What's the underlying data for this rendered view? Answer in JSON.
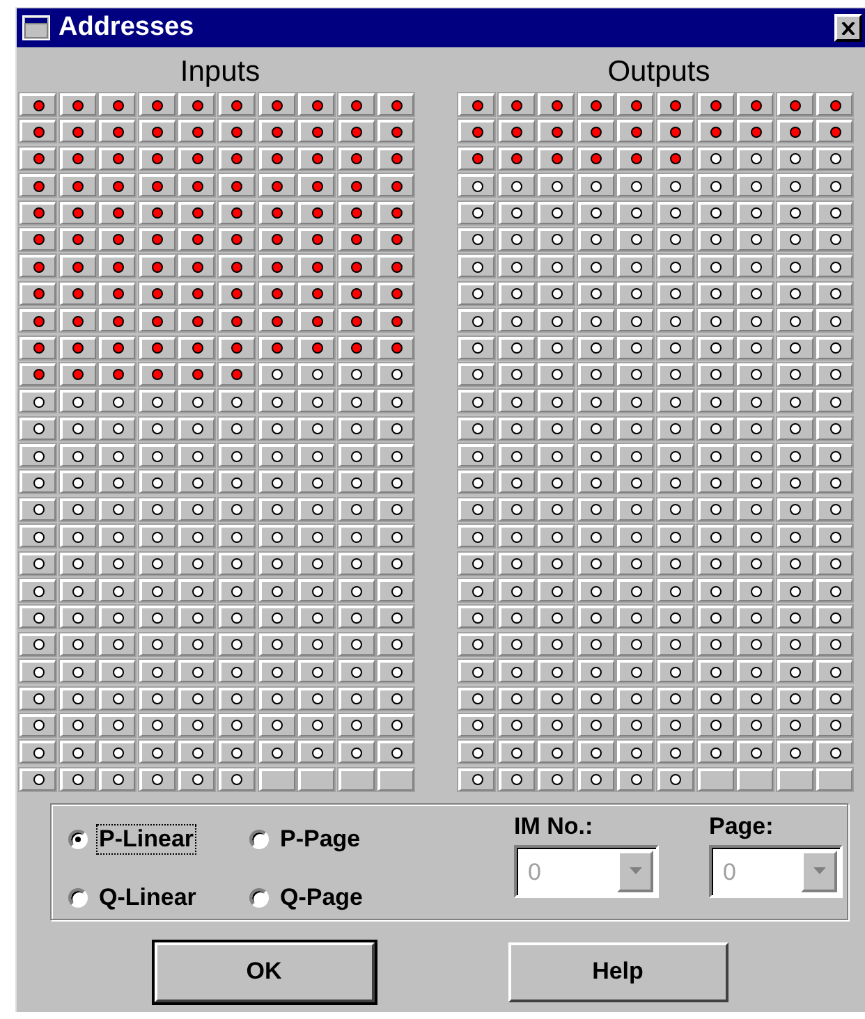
{
  "window": {
    "title": "Addresses"
  },
  "panels": [
    {
      "label": "Inputs",
      "rows": [
        [
          {
            "on": true
          },
          {
            "on": true
          },
          {
            "on": true
          },
          {
            "on": true
          },
          {
            "on": true
          },
          {
            "on": true
          },
          {
            "on": true
          },
          {
            "on": true
          },
          {
            "on": true
          },
          {
            "on": true
          }
        ],
        [
          {
            "on": true
          },
          {
            "on": true
          },
          {
            "on": true
          },
          {
            "on": true
          },
          {
            "on": true
          },
          {
            "on": true
          },
          {
            "on": true
          },
          {
            "on": true
          },
          {
            "on": true
          },
          {
            "on": true
          }
        ],
        [
          {
            "on": true
          },
          {
            "on": true
          },
          {
            "on": true
          },
          {
            "on": true
          },
          {
            "on": true
          },
          {
            "on": true
          },
          {
            "on": true
          },
          {
            "on": true
          },
          {
            "on": true
          },
          {
            "on": true
          }
        ],
        [
          {
            "on": true
          },
          {
            "on": true
          },
          {
            "on": true
          },
          {
            "on": true
          },
          {
            "on": true
          },
          {
            "on": true
          },
          {
            "on": true
          },
          {
            "on": true
          },
          {
            "on": true
          },
          {
            "on": true
          }
        ],
        [
          {
            "on": true
          },
          {
            "on": true
          },
          {
            "on": true
          },
          {
            "on": true
          },
          {
            "on": true
          },
          {
            "on": true
          },
          {
            "on": true
          },
          {
            "on": true
          },
          {
            "on": true
          },
          {
            "on": true
          }
        ],
        [
          {
            "on": true
          },
          {
            "on": true
          },
          {
            "on": true
          },
          {
            "on": true
          },
          {
            "on": true
          },
          {
            "on": true
          },
          {
            "on": true
          },
          {
            "on": true
          },
          {
            "on": true
          },
          {
            "on": true
          }
        ],
        [
          {
            "on": true
          },
          {
            "on": true
          },
          {
            "on": true
          },
          {
            "on": true
          },
          {
            "on": true
          },
          {
            "on": true
          },
          {
            "on": true
          },
          {
            "on": true
          },
          {
            "on": true
          },
          {
            "on": true
          }
        ],
        [
          {
            "on": true
          },
          {
            "on": true
          },
          {
            "on": true
          },
          {
            "on": true
          },
          {
            "on": true
          },
          {
            "on": true
          },
          {
            "on": true
          },
          {
            "on": true
          },
          {
            "on": true
          },
          {
            "on": true
          }
        ],
        [
          {
            "on": true
          },
          {
            "on": true
          },
          {
            "on": true
          },
          {
            "on": true
          },
          {
            "on": true
          },
          {
            "on": true
          },
          {
            "on": true
          },
          {
            "on": true
          },
          {
            "on": true
          },
          {
            "on": true
          }
        ],
        [
          {
            "on": true
          },
          {
            "on": true
          },
          {
            "on": true
          },
          {
            "on": true
          },
          {
            "on": true
          },
          {
            "on": true
          },
          {
            "on": true
          },
          {
            "on": true
          },
          {
            "on": true
          },
          {
            "on": true
          }
        ],
        [
          {
            "on": true
          },
          {
            "on": true
          },
          {
            "on": true
          },
          {
            "on": true
          },
          {
            "on": true
          },
          {
            "on": true
          },
          {
            "on": false
          },
          {
            "on": false
          },
          {
            "on": false
          },
          {
            "on": false
          }
        ],
        [
          {
            "on": false
          },
          {
            "on": false
          },
          {
            "on": false
          },
          {
            "on": false
          },
          {
            "on": false
          },
          {
            "on": false
          },
          {
            "on": false
          },
          {
            "on": false
          },
          {
            "on": false
          },
          {
            "on": false
          }
        ],
        [
          {
            "on": false
          },
          {
            "on": false
          },
          {
            "on": false
          },
          {
            "on": false
          },
          {
            "on": false
          },
          {
            "on": false
          },
          {
            "on": false
          },
          {
            "on": false
          },
          {
            "on": false
          },
          {
            "on": false
          }
        ],
        [
          {
            "on": false
          },
          {
            "on": false
          },
          {
            "on": false
          },
          {
            "on": false
          },
          {
            "on": false
          },
          {
            "on": false
          },
          {
            "on": false
          },
          {
            "on": false
          },
          {
            "on": false
          },
          {
            "on": false
          }
        ],
        [
          {
            "on": false
          },
          {
            "on": false
          },
          {
            "on": false
          },
          {
            "on": false
          },
          {
            "on": false
          },
          {
            "on": false
          },
          {
            "on": false
          },
          {
            "on": false
          },
          {
            "on": false
          },
          {
            "on": false
          }
        ],
        [
          {
            "on": false
          },
          {
            "on": false
          },
          {
            "on": false
          },
          {
            "on": false
          },
          {
            "on": false
          },
          {
            "on": false
          },
          {
            "on": false
          },
          {
            "on": false
          },
          {
            "on": false
          },
          {
            "on": false
          }
        ],
        [
          {
            "on": false
          },
          {
            "on": false
          },
          {
            "on": false
          },
          {
            "on": false
          },
          {
            "on": false
          },
          {
            "on": false
          },
          {
            "on": false
          },
          {
            "on": false
          },
          {
            "on": false
          },
          {
            "on": false
          }
        ],
        [
          {
            "on": false
          },
          {
            "on": false
          },
          {
            "on": false
          },
          {
            "on": false
          },
          {
            "on": false
          },
          {
            "on": false
          },
          {
            "on": false
          },
          {
            "on": false
          },
          {
            "on": false
          },
          {
            "on": false
          }
        ],
        [
          {
            "on": false
          },
          {
            "on": false
          },
          {
            "on": false
          },
          {
            "on": false
          },
          {
            "on": false
          },
          {
            "on": false
          },
          {
            "on": false
          },
          {
            "on": false
          },
          {
            "on": false
          },
          {
            "on": false
          }
        ],
        [
          {
            "on": false
          },
          {
            "on": false
          },
          {
            "on": false
          },
          {
            "on": false
          },
          {
            "on": false
          },
          {
            "on": false
          },
          {
            "on": false
          },
          {
            "on": false
          },
          {
            "on": false
          },
          {
            "on": false
          }
        ],
        [
          {
            "on": false
          },
          {
            "on": false
          },
          {
            "on": false
          },
          {
            "on": false
          },
          {
            "on": false
          },
          {
            "on": false
          },
          {
            "on": false
          },
          {
            "on": false
          },
          {
            "on": false
          },
          {
            "on": false
          }
        ],
        [
          {
            "on": false
          },
          {
            "on": false
          },
          {
            "on": false
          },
          {
            "on": false
          },
          {
            "on": false
          },
          {
            "on": false
          },
          {
            "on": false
          },
          {
            "on": false
          },
          {
            "on": false
          },
          {
            "on": false
          }
        ],
        [
          {
            "on": false
          },
          {
            "on": false
          },
          {
            "on": false
          },
          {
            "on": false
          },
          {
            "on": false
          },
          {
            "on": false
          },
          {
            "on": false
          },
          {
            "on": false
          },
          {
            "on": false
          },
          {
            "on": false
          }
        ],
        [
          {
            "on": false
          },
          {
            "on": false
          },
          {
            "on": false
          },
          {
            "on": false
          },
          {
            "on": false
          },
          {
            "on": false
          },
          {
            "on": false
          },
          {
            "on": false
          },
          {
            "on": false
          },
          {
            "on": false
          }
        ],
        [
          {
            "on": false
          },
          {
            "on": false
          },
          {
            "on": false
          },
          {
            "on": false
          },
          {
            "on": false
          },
          {
            "on": false
          },
          {
            "on": false
          },
          {
            "on": false
          },
          {
            "on": false
          },
          {
            "on": false
          }
        ],
        [
          {
            "on": false
          },
          {
            "on": false
          },
          {
            "on": false
          },
          {
            "on": false
          },
          {
            "on": false
          },
          {
            "on": false
          }
        ]
      ]
    },
    {
      "label": "Outputs",
      "rows": [
        [
          {
            "on": true
          },
          {
            "on": true
          },
          {
            "on": true
          },
          {
            "on": true
          },
          {
            "on": true
          },
          {
            "on": true
          },
          {
            "on": true
          },
          {
            "on": true
          },
          {
            "on": true
          },
          {
            "on": true
          }
        ],
        [
          {
            "on": true
          },
          {
            "on": true
          },
          {
            "on": true
          },
          {
            "on": true
          },
          {
            "on": true
          },
          {
            "on": true
          },
          {
            "on": true
          },
          {
            "on": true
          },
          {
            "on": true
          },
          {
            "on": true
          }
        ],
        [
          {
            "on": true
          },
          {
            "on": true
          },
          {
            "on": true
          },
          {
            "on": true
          },
          {
            "on": true
          },
          {
            "on": true
          },
          {
            "on": false
          },
          {
            "on": false
          },
          {
            "on": false
          },
          {
            "on": false
          }
        ],
        [
          {
            "on": false
          },
          {
            "on": false
          },
          {
            "on": false
          },
          {
            "on": false
          },
          {
            "on": false
          },
          {
            "on": false
          },
          {
            "on": false
          },
          {
            "on": false
          },
          {
            "on": false
          },
          {
            "on": false
          }
        ],
        [
          {
            "on": false
          },
          {
            "on": false
          },
          {
            "on": false
          },
          {
            "on": false
          },
          {
            "on": false
          },
          {
            "on": false
          },
          {
            "on": false
          },
          {
            "on": false
          },
          {
            "on": false
          },
          {
            "on": false
          }
        ],
        [
          {
            "on": false
          },
          {
            "on": false
          },
          {
            "on": false
          },
          {
            "on": false
          },
          {
            "on": false
          },
          {
            "on": false
          },
          {
            "on": false
          },
          {
            "on": false
          },
          {
            "on": false
          },
          {
            "on": false
          }
        ],
        [
          {
            "on": false
          },
          {
            "on": false
          },
          {
            "on": false
          },
          {
            "on": false
          },
          {
            "on": false
          },
          {
            "on": false
          },
          {
            "on": false
          },
          {
            "on": false
          },
          {
            "on": false
          },
          {
            "on": false
          }
        ],
        [
          {
            "on": false
          },
          {
            "on": false
          },
          {
            "on": false
          },
          {
            "on": false
          },
          {
            "on": false
          },
          {
            "on": false
          },
          {
            "on": false
          },
          {
            "on": false
          },
          {
            "on": false
          },
          {
            "on": false
          }
        ],
        [
          {
            "on": false
          },
          {
            "on": false
          },
          {
            "on": false
          },
          {
            "on": false
          },
          {
            "on": false
          },
          {
            "on": false
          },
          {
            "on": false
          },
          {
            "on": false
          },
          {
            "on": false
          },
          {
            "on": false
          }
        ],
        [
          {
            "on": false
          },
          {
            "on": false
          },
          {
            "on": false
          },
          {
            "on": false
          },
          {
            "on": false
          },
          {
            "on": false
          },
          {
            "on": false
          },
          {
            "on": false
          },
          {
            "on": false
          },
          {
            "on": false
          }
        ],
        [
          {
            "on": false
          },
          {
            "on": false
          },
          {
            "on": false
          },
          {
            "on": false
          },
          {
            "on": false
          },
          {
            "on": false
          },
          {
            "on": false
          },
          {
            "on": false
          },
          {
            "on": false
          },
          {
            "on": false
          }
        ],
        [
          {
            "on": false
          },
          {
            "on": false
          },
          {
            "on": false
          },
          {
            "on": false
          },
          {
            "on": false
          },
          {
            "on": false
          },
          {
            "on": false
          },
          {
            "on": false
          },
          {
            "on": false
          },
          {
            "on": false
          }
        ],
        [
          {
            "on": false
          },
          {
            "on": false
          },
          {
            "on": false
          },
          {
            "on": false
          },
          {
            "on": false
          },
          {
            "on": false
          },
          {
            "on": false
          },
          {
            "on": false
          },
          {
            "on": false
          },
          {
            "on": false
          }
        ],
        [
          {
            "on": false
          },
          {
            "on": false
          },
          {
            "on": false
          },
          {
            "on": false
          },
          {
            "on": false
          },
          {
            "on": false
          },
          {
            "on": false
          },
          {
            "on": false
          },
          {
            "on": false
          },
          {
            "on": false
          }
        ],
        [
          {
            "on": false
          },
          {
            "on": false
          },
          {
            "on": false
          },
          {
            "on": false
          },
          {
            "on": false
          },
          {
            "on": false
          },
          {
            "on": false
          },
          {
            "on": false
          },
          {
            "on": false
          },
          {
            "on": false
          }
        ],
        [
          {
            "on": false
          },
          {
            "on": false
          },
          {
            "on": false
          },
          {
            "on": false
          },
          {
            "on": false
          },
          {
            "on": false
          },
          {
            "on": false
          },
          {
            "on": false
          },
          {
            "on": false
          },
          {
            "on": false
          }
        ],
        [
          {
            "on": false
          },
          {
            "on": false
          },
          {
            "on": false
          },
          {
            "on": false
          },
          {
            "on": false
          },
          {
            "on": false
          },
          {
            "on": false
          },
          {
            "on": false
          },
          {
            "on": false
          },
          {
            "on": false
          }
        ],
        [
          {
            "on": false
          },
          {
            "on": false
          },
          {
            "on": false
          },
          {
            "on": false
          },
          {
            "on": false
          },
          {
            "on": false
          },
          {
            "on": false
          },
          {
            "on": false
          },
          {
            "on": false
          },
          {
            "on": false
          }
        ],
        [
          {
            "on": false
          },
          {
            "on": false
          },
          {
            "on": false
          },
          {
            "on": false
          },
          {
            "on": false
          },
          {
            "on": false
          },
          {
            "on": false
          },
          {
            "on": false
          },
          {
            "on": false
          },
          {
            "on": false
          }
        ],
        [
          {
            "on": false
          },
          {
            "on": false
          },
          {
            "on": false
          },
          {
            "on": false
          },
          {
            "on": false
          },
          {
            "on": false
          },
          {
            "on": false
          },
          {
            "on": false
          },
          {
            "on": false
          },
          {
            "on": false
          }
        ],
        [
          {
            "on": false
          },
          {
            "on": false
          },
          {
            "on": false
          },
          {
            "on": false
          },
          {
            "on": false
          },
          {
            "on": false
          },
          {
            "on": false
          },
          {
            "on": false
          },
          {
            "on": false
          },
          {
            "on": false
          }
        ],
        [
          {
            "on": false
          },
          {
            "on": false
          },
          {
            "on": false
          },
          {
            "on": false
          },
          {
            "on": false
          },
          {
            "on": false
          },
          {
            "on": false
          },
          {
            "on": false
          },
          {
            "on": false
          },
          {
            "on": false
          }
        ],
        [
          {
            "on": false
          },
          {
            "on": false
          },
          {
            "on": false
          },
          {
            "on": false
          },
          {
            "on": false
          },
          {
            "on": false
          },
          {
            "on": false
          },
          {
            "on": false
          },
          {
            "on": false
          },
          {
            "on": false
          }
        ],
        [
          {
            "on": false
          },
          {
            "on": false
          },
          {
            "on": false
          },
          {
            "on": false
          },
          {
            "on": false
          },
          {
            "on": false
          },
          {
            "on": false
          },
          {
            "on": false
          },
          {
            "on": false
          },
          {
            "on": false
          }
        ],
        [
          {
            "on": false
          },
          {
            "on": false
          },
          {
            "on": false
          },
          {
            "on": false
          },
          {
            "on": false
          },
          {
            "on": false
          },
          {
            "on": false
          },
          {
            "on": false
          },
          {
            "on": false
          },
          {
            "on": false
          }
        ],
        [
          {
            "on": false
          },
          {
            "on": false
          },
          {
            "on": false
          },
          {
            "on": false
          },
          {
            "on": false
          },
          {
            "on": false
          }
        ]
      ]
    }
  ],
  "modes": [
    {
      "label": "P-Linear",
      "selected": true,
      "focused": true
    },
    {
      "label": "P-Page",
      "selected": false,
      "focused": false
    },
    {
      "label": "Q-Linear",
      "selected": false,
      "focused": false
    },
    {
      "label": "Q-Page",
      "selected": false,
      "focused": false
    }
  ],
  "selectors": [
    {
      "label": "IM No.:",
      "value": "0",
      "disabled": true
    },
    {
      "label": "Page:",
      "value": "0",
      "disabled": true
    }
  ],
  "buttons": [
    {
      "label": "OK",
      "default": true
    },
    {
      "label": "Help",
      "default": false
    }
  ]
}
